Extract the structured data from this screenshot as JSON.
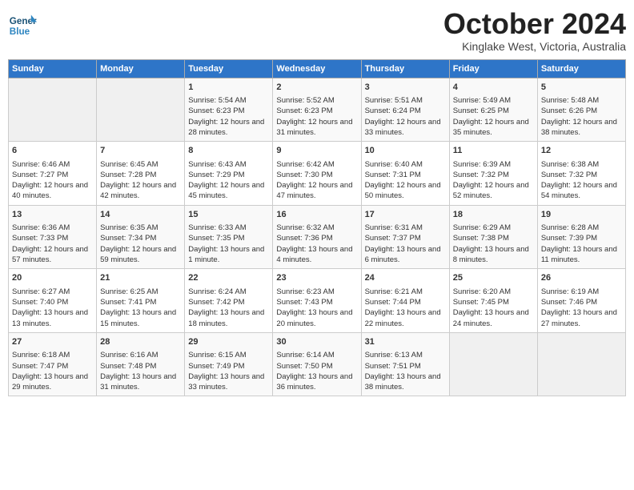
{
  "logo": {
    "general": "General",
    "blue": "Blue"
  },
  "title": "October 2024",
  "location": "Kinglake West, Victoria, Australia",
  "weekdays": [
    "Sunday",
    "Monday",
    "Tuesday",
    "Wednesday",
    "Thursday",
    "Friday",
    "Saturday"
  ],
  "weeks": [
    [
      {
        "day": "",
        "info": ""
      },
      {
        "day": "",
        "info": ""
      },
      {
        "day": "1",
        "info": "Sunrise: 5:54 AM\nSunset: 6:23 PM\nDaylight: 12 hours and 28 minutes."
      },
      {
        "day": "2",
        "info": "Sunrise: 5:52 AM\nSunset: 6:23 PM\nDaylight: 12 hours and 31 minutes."
      },
      {
        "day": "3",
        "info": "Sunrise: 5:51 AM\nSunset: 6:24 PM\nDaylight: 12 hours and 33 minutes."
      },
      {
        "day": "4",
        "info": "Sunrise: 5:49 AM\nSunset: 6:25 PM\nDaylight: 12 hours and 35 minutes."
      },
      {
        "day": "5",
        "info": "Sunrise: 5:48 AM\nSunset: 6:26 PM\nDaylight: 12 hours and 38 minutes."
      }
    ],
    [
      {
        "day": "6",
        "info": "Sunrise: 6:46 AM\nSunset: 7:27 PM\nDaylight: 12 hours and 40 minutes."
      },
      {
        "day": "7",
        "info": "Sunrise: 6:45 AM\nSunset: 7:28 PM\nDaylight: 12 hours and 42 minutes."
      },
      {
        "day": "8",
        "info": "Sunrise: 6:43 AM\nSunset: 7:29 PM\nDaylight: 12 hours and 45 minutes."
      },
      {
        "day": "9",
        "info": "Sunrise: 6:42 AM\nSunset: 7:30 PM\nDaylight: 12 hours and 47 minutes."
      },
      {
        "day": "10",
        "info": "Sunrise: 6:40 AM\nSunset: 7:31 PM\nDaylight: 12 hours and 50 minutes."
      },
      {
        "day": "11",
        "info": "Sunrise: 6:39 AM\nSunset: 7:32 PM\nDaylight: 12 hours and 52 minutes."
      },
      {
        "day": "12",
        "info": "Sunrise: 6:38 AM\nSunset: 7:32 PM\nDaylight: 12 hours and 54 minutes."
      }
    ],
    [
      {
        "day": "13",
        "info": "Sunrise: 6:36 AM\nSunset: 7:33 PM\nDaylight: 12 hours and 57 minutes."
      },
      {
        "day": "14",
        "info": "Sunrise: 6:35 AM\nSunset: 7:34 PM\nDaylight: 12 hours and 59 minutes."
      },
      {
        "day": "15",
        "info": "Sunrise: 6:33 AM\nSunset: 7:35 PM\nDaylight: 13 hours and 1 minute."
      },
      {
        "day": "16",
        "info": "Sunrise: 6:32 AM\nSunset: 7:36 PM\nDaylight: 13 hours and 4 minutes."
      },
      {
        "day": "17",
        "info": "Sunrise: 6:31 AM\nSunset: 7:37 PM\nDaylight: 13 hours and 6 minutes."
      },
      {
        "day": "18",
        "info": "Sunrise: 6:29 AM\nSunset: 7:38 PM\nDaylight: 13 hours and 8 minutes."
      },
      {
        "day": "19",
        "info": "Sunrise: 6:28 AM\nSunset: 7:39 PM\nDaylight: 13 hours and 11 minutes."
      }
    ],
    [
      {
        "day": "20",
        "info": "Sunrise: 6:27 AM\nSunset: 7:40 PM\nDaylight: 13 hours and 13 minutes."
      },
      {
        "day": "21",
        "info": "Sunrise: 6:25 AM\nSunset: 7:41 PM\nDaylight: 13 hours and 15 minutes."
      },
      {
        "day": "22",
        "info": "Sunrise: 6:24 AM\nSunset: 7:42 PM\nDaylight: 13 hours and 18 minutes."
      },
      {
        "day": "23",
        "info": "Sunrise: 6:23 AM\nSunset: 7:43 PM\nDaylight: 13 hours and 20 minutes."
      },
      {
        "day": "24",
        "info": "Sunrise: 6:21 AM\nSunset: 7:44 PM\nDaylight: 13 hours and 22 minutes."
      },
      {
        "day": "25",
        "info": "Sunrise: 6:20 AM\nSunset: 7:45 PM\nDaylight: 13 hours and 24 minutes."
      },
      {
        "day": "26",
        "info": "Sunrise: 6:19 AM\nSunset: 7:46 PM\nDaylight: 13 hours and 27 minutes."
      }
    ],
    [
      {
        "day": "27",
        "info": "Sunrise: 6:18 AM\nSunset: 7:47 PM\nDaylight: 13 hours and 29 minutes."
      },
      {
        "day": "28",
        "info": "Sunrise: 6:16 AM\nSunset: 7:48 PM\nDaylight: 13 hours and 31 minutes."
      },
      {
        "day": "29",
        "info": "Sunrise: 6:15 AM\nSunset: 7:49 PM\nDaylight: 13 hours and 33 minutes."
      },
      {
        "day": "30",
        "info": "Sunrise: 6:14 AM\nSunset: 7:50 PM\nDaylight: 13 hours and 36 minutes."
      },
      {
        "day": "31",
        "info": "Sunrise: 6:13 AM\nSunset: 7:51 PM\nDaylight: 13 hours and 38 minutes."
      },
      {
        "day": "",
        "info": ""
      },
      {
        "day": "",
        "info": ""
      }
    ]
  ]
}
